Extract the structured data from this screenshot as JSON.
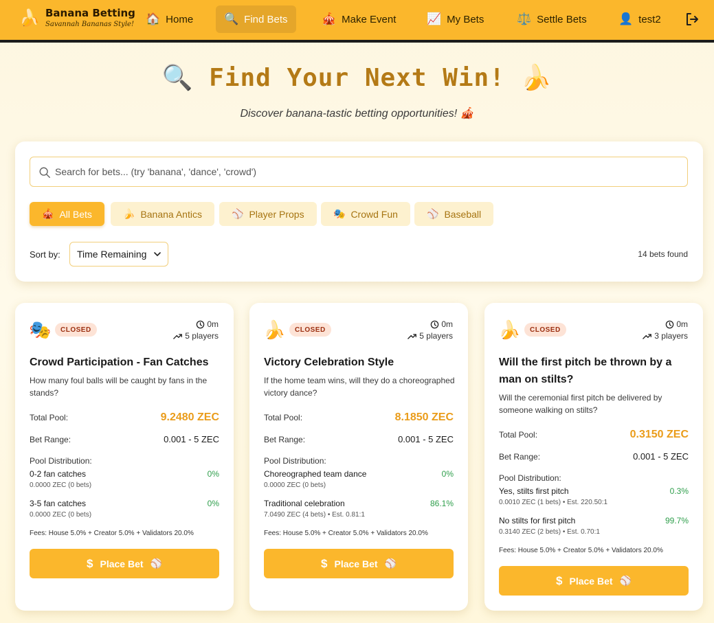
{
  "nav": {
    "brand_title": "Banana Betting",
    "brand_subtitle": "Savannah Bananas Style!",
    "brand_icon": "🍌",
    "items": [
      {
        "icon": "🏠",
        "label": "Home"
      },
      {
        "icon": "🔍",
        "label": "Find Bets"
      },
      {
        "icon": "🎪",
        "label": "Make Event"
      },
      {
        "icon": "📈",
        "label": "My Bets"
      },
      {
        "icon": "⚖️",
        "label": "Settle Bets"
      },
      {
        "icon": "👤",
        "label": "test2"
      }
    ],
    "active": "Find Bets"
  },
  "hero": {
    "title": "🔍 Find Your Next Win! 🍌",
    "subtitle": "Discover banana-tastic betting opportunities! 🎪"
  },
  "search": {
    "placeholder": "Search for bets... (try 'banana', 'dance', 'crowd')",
    "value": ""
  },
  "filters": [
    {
      "icon": "🎪",
      "label": "All Bets",
      "active": true
    },
    {
      "icon": "🍌",
      "label": "Banana Antics",
      "active": false
    },
    {
      "icon": "⚾",
      "label": "Player Props",
      "active": false
    },
    {
      "icon": "🎭",
      "label": "Crowd Fun",
      "active": false
    },
    {
      "icon": "⚾",
      "label": "Baseball",
      "active": false
    }
  ],
  "sort": {
    "label": "Sort by:",
    "selected": "Time Remaining"
  },
  "results_count": "14 bets found",
  "cards": [
    {
      "icon": "🎭",
      "status": "CLOSED",
      "time": "0m",
      "players": "5 players",
      "title": "Crowd Participation - Fan Catches",
      "description": "How many foul balls will be caught by fans in the stands?",
      "total_pool_label": "Total Pool:",
      "total_pool": "9.2480 ZEC",
      "bet_range_label": "Bet Range:",
      "bet_range": "0.001 - 5 ZEC",
      "distribution_label": "Pool Distribution:",
      "options": [
        {
          "name": "0-2 fan catches",
          "pct": "0%",
          "detail": "0.0000 ZEC (0 bets)"
        },
        {
          "name": "3-5 fan catches",
          "pct": "0%",
          "detail": "0.0000 ZEC (0 bets)"
        }
      ],
      "fees": "Fees: House 5.0% + Creator 5.0% + Validators 20.0%",
      "button_label": "Place Bet"
    },
    {
      "icon": "🍌",
      "status": "CLOSED",
      "time": "0m",
      "players": "5 players",
      "title": "Victory Celebration Style",
      "description": "If the home team wins, will they do a choreographed victory dance?",
      "total_pool_label": "Total Pool:",
      "total_pool": "8.1850 ZEC",
      "bet_range_label": "Bet Range:",
      "bet_range": "0.001 - 5 ZEC",
      "distribution_label": "Pool Distribution:",
      "options": [
        {
          "name": "Choreographed team dance",
          "pct": "0%",
          "detail": "0.0000 ZEC (0 bets)"
        },
        {
          "name": "Traditional celebration",
          "pct": "86.1%",
          "detail": "7.0490 ZEC (4 bets) • Est. 0.81:1"
        }
      ],
      "fees": "Fees: House 5.0% + Creator 5.0% + Validators 20.0%",
      "button_label": "Place Bet"
    },
    {
      "icon": "🍌",
      "status": "CLOSED",
      "time": "0m",
      "players": "3 players",
      "title": "Will the first pitch be thrown by a man on stilts?",
      "description": "Will the ceremonial first pitch be delivered by someone walking on stilts?",
      "total_pool_label": "Total Pool:",
      "total_pool": "0.3150 ZEC",
      "bet_range_label": "Bet Range:",
      "bet_range": "0.001 - 5 ZEC",
      "distribution_label": "Pool Distribution:",
      "options": [
        {
          "name": "Yes, stilts first pitch",
          "pct": "0.3%",
          "detail": "0.0010 ZEC (1 bets) • Est. 220.50:1"
        },
        {
          "name": "No stilts for first pitch",
          "pct": "99.7%",
          "detail": "0.3140 ZEC (2 bets) • Est. 0.70:1"
        }
      ],
      "fees": "Fees: House 5.0% + Creator 5.0% + Validators 20.0%",
      "button_label": "Place Bet"
    }
  ],
  "colors": {
    "primary": "#fbb72c",
    "pool_value": "#ea9c1a",
    "percent": "#2e9e4b",
    "badge_bg": "#fde3d6",
    "badge_text": "#9c2f10"
  }
}
